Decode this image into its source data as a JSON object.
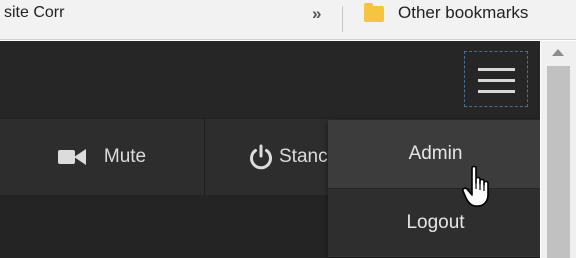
{
  "bookmarks_bar": {
    "left_item": "site Corr",
    "overflow_chevron": "»",
    "other_bookmarks": "Other bookmarks"
  },
  "controls": {
    "mute_label": "Mute",
    "standby_label": "Stanc"
  },
  "menu": {
    "items": [
      {
        "label": "Admin"
      },
      {
        "label": "Logout"
      }
    ]
  },
  "icons": {
    "folder": "folder-icon",
    "hamburger": "hamburger-menu-icon",
    "camera": "video-camera-icon",
    "power": "power-icon",
    "cursor": "hand-pointer-icon"
  },
  "colors": {
    "page_bg": "#242424",
    "menu_bg": "#333333",
    "menu_hover": "#3c3c3c",
    "text": "#dcdcdc"
  }
}
